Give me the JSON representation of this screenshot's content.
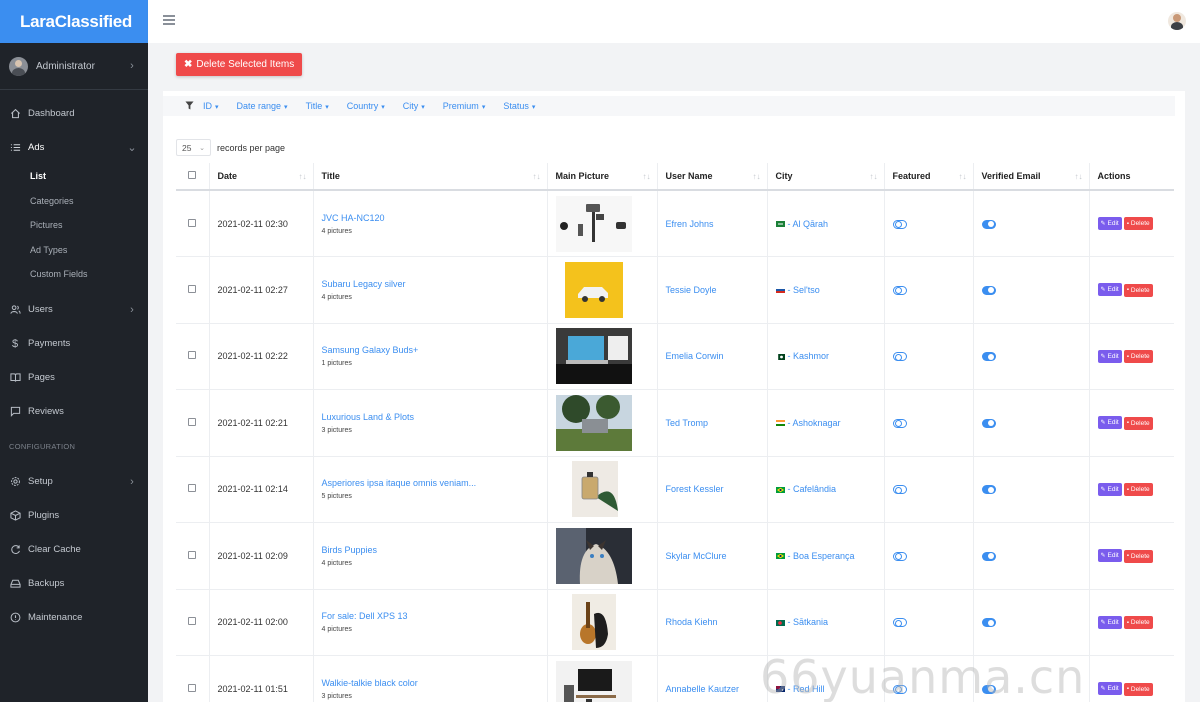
{
  "brand": "LaraClassified",
  "user": {
    "name": "Administrator"
  },
  "sidebar": {
    "items": [
      {
        "label": "Dashboard",
        "icon": "home-icon"
      },
      {
        "label": "Ads",
        "icon": "list-icon"
      },
      {
        "label": "Users",
        "icon": "users-icon"
      },
      {
        "label": "Payments",
        "icon": "dollar-icon"
      },
      {
        "label": "Pages",
        "icon": "book-icon"
      },
      {
        "label": "Reviews",
        "icon": "comment-icon"
      }
    ],
    "ads_sub": [
      "List",
      "Categories",
      "Pictures",
      "Ad Types",
      "Custom Fields"
    ],
    "config_heading": "CONFIGURATION",
    "config_items": [
      {
        "label": "Setup",
        "icon": "gear-icon"
      },
      {
        "label": "Plugins",
        "icon": "package-icon"
      },
      {
        "label": "Clear Cache",
        "icon": "refresh-icon"
      },
      {
        "label": "Backups",
        "icon": "drive-icon"
      },
      {
        "label": "Maintenance",
        "icon": "info-icon"
      }
    ]
  },
  "toolbar": {
    "delete_selected": "Delete Selected Items"
  },
  "filters": [
    "ID",
    "Date range",
    "Title",
    "Country",
    "City",
    "Premium",
    "Status"
  ],
  "perpage": {
    "value": "25",
    "label": "records per page"
  },
  "table": {
    "headers": [
      "Date",
      "Title",
      "Main Picture",
      "User Name",
      "City",
      "Featured",
      "Verified Email",
      "Actions"
    ],
    "edit_label": "Edit",
    "delete_label": "Delete",
    "rows": [
      {
        "date": "2021-02-11 02:30",
        "title": "JVC HA-NC120",
        "pictures": "4 pictures",
        "user": "Efren Johns",
        "city": "- Al Qārah",
        "flag": "sa",
        "featured": false,
        "verified": true
      },
      {
        "date": "2021-02-11 02:27",
        "title": "Subaru Legacy silver",
        "pictures": "4 pictures",
        "user": "Tessie Doyle",
        "city": "- Sel'tso",
        "flag": "ru",
        "featured": false,
        "verified": true
      },
      {
        "date": "2021-02-11 02:22",
        "title": "Samsung Galaxy Buds+",
        "pictures": "1 pictures",
        "user": "Emelia Corwin",
        "city": "- Kashmor",
        "flag": "pk",
        "featured": false,
        "verified": true
      },
      {
        "date": "2021-02-11 02:21",
        "title": "Luxurious Land & Plots",
        "pictures": "3 pictures",
        "user": "Ted Tromp",
        "city": "- Ashoknagar",
        "flag": "in",
        "featured": false,
        "verified": true
      },
      {
        "date": "2021-02-11 02:14",
        "title": "Asperiores ipsa itaque omnis veniam...",
        "pictures": "5 pictures",
        "user": "Forest Kessler",
        "city": "- Cafelândia",
        "flag": "br",
        "featured": false,
        "verified": true
      },
      {
        "date": "2021-02-11 02:09",
        "title": "Birds Puppies",
        "pictures": "4 pictures",
        "user": "Skylar McClure",
        "city": "- Boa Esperança",
        "flag": "br",
        "featured": false,
        "verified": true
      },
      {
        "date": "2021-02-11 02:00",
        "title": "For sale: Dell XPS 13",
        "pictures": "4 pictures",
        "user": "Rhoda Kiehn",
        "city": "- Sātkania",
        "flag": "bd",
        "featured": false,
        "verified": true
      },
      {
        "date": "2021-02-11 01:51",
        "title": "Walkie-talkie black color",
        "pictures": "3 pictures",
        "user": "Annabelle Kautzer",
        "city": "- Red Hill",
        "flag": "au",
        "featured": false,
        "verified": true
      }
    ]
  },
  "watermark": "66yuanma.cn"
}
